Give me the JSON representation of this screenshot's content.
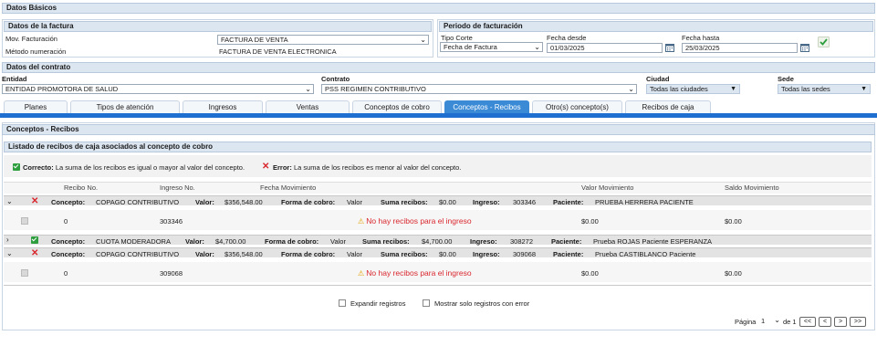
{
  "datos_basicos": {
    "title": "Datos Básicos",
    "factura": {
      "title": "Datos de la factura",
      "mov_label": "Mov. Facturación",
      "mov_value": "FACTURA DE VENTA",
      "metodo_label": "Método numeración",
      "metodo_value": "FACTURA DE VENTA ELECTRONICA"
    },
    "periodo": {
      "title": "Periodo de facturación",
      "tipo_corte_label": "Tipo Corte",
      "tipo_corte_value": "Fecha de Factura",
      "desde_label": "Fecha desde",
      "desde_value": "01/03/2025",
      "hasta_label": "Fecha hasta",
      "hasta_value": "25/03/2025"
    }
  },
  "contrato": {
    "title": "Datos del contrato",
    "entidad_label": "Entidad",
    "entidad_value": "ENTIDAD PROMOTORA DE SALUD",
    "contrato_label": "Contrato",
    "contrato_value": "PSS REGIMEN CONTRIBUTIVO",
    "ciudad_label": "Ciudad",
    "ciudad_value": "Todas las ciudades",
    "sede_label": "Sede",
    "sede_value": "Todas las sedes"
  },
  "tabs": [
    {
      "label": "Planes"
    },
    {
      "label": "Tipos de atención"
    },
    {
      "label": "Ingresos"
    },
    {
      "label": "Ventas"
    },
    {
      "label": "Conceptos de cobro"
    },
    {
      "label": "Conceptos - Recibos"
    },
    {
      "label": "Otro(s) concepto(s)"
    },
    {
      "label": "Recibos de caja"
    }
  ],
  "recibos": {
    "title": "Conceptos - Recibos",
    "list_title": "Listado de recibos de caja asociados al concepto de cobro",
    "legend_ok_bold": "Correcto:",
    "legend_ok_text": "La suma de los recibos es igual o mayor al valor del concepto.",
    "legend_err_bold": "Error:",
    "legend_err_text": "La suma de los recibos es menor al valor del concepto.",
    "columns": [
      "Recibo No.",
      "Ingreso No.",
      "Fecha Movimiento",
      "Valor Movimiento",
      "Saldo Movimiento"
    ],
    "labels": {
      "concepto": "Concepto:",
      "valor": "Valor:",
      "forma": "Forma de cobro:",
      "suma": "Suma recibos:",
      "ingreso": "Ingreso:",
      "paciente": "Paciente:"
    },
    "groups": [
      {
        "expanded": true,
        "status": "error",
        "concepto": "COPAGO CONTRIBUTIVO",
        "valor": "$356,548.00",
        "forma": "Valor",
        "suma": "$0.00",
        "ingreso": "303346",
        "paciente": "PRUEBA HERRERA PACIENTE",
        "detail": {
          "recibo": "0",
          "ingreso": "303346",
          "message": "No hay recibos para el ingreso",
          "valor": "$0.00",
          "saldo": "$0.00"
        }
      },
      {
        "expanded": false,
        "status": "ok",
        "concepto": "CUOTA MODERADORA",
        "valor": "$4,700.00",
        "forma": "Valor",
        "suma": "$4,700.00",
        "ingreso": "308272",
        "paciente": "Prueba ROJAS Paciente ESPERANZA"
      },
      {
        "expanded": true,
        "status": "error",
        "concepto": "COPAGO CONTRIBUTIVO",
        "valor": "$356,548.00",
        "forma": "Valor",
        "suma": "$0.00",
        "ingreso": "309068",
        "paciente": "Prueba CASTIBLANCO Paciente",
        "detail": {
          "recibo": "0",
          "ingreso": "309068",
          "message": "No hay recibos para el ingreso",
          "valor": "$0.00",
          "saldo": "$0.00"
        }
      }
    ],
    "expandir_label": "Expandir registros",
    "solo_error_label": "Mostrar solo registros con error"
  },
  "pagination": {
    "pagina_label": "Página",
    "page_value": "1",
    "of_label": "de 1",
    "first": "<<",
    "prev": "<",
    "next": ">",
    "last": ">>"
  }
}
